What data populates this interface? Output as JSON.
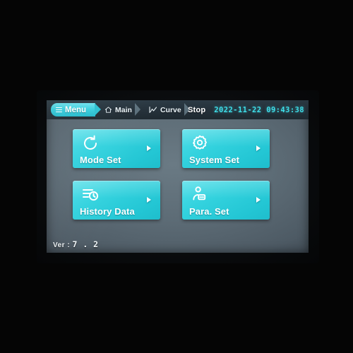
{
  "device": {
    "screen_label": "hmi-touch-panel"
  },
  "topbar": {
    "menu_label": "Menu",
    "menu_icon": "hamburger-icon",
    "breadcrumbs": [
      {
        "label": "Main",
        "icon": "home-icon"
      },
      {
        "label": "Curve",
        "icon": "line-chart-icon"
      }
    ],
    "status": "Stop",
    "datetime": "2022-11-22 09:43:38",
    "accent_color": "#3acfde",
    "bar_color": "#243039",
    "datetime_color": "#3fe0ea"
  },
  "menu": {
    "tiles": [
      {
        "label": "Mode Set",
        "icon": "rotate-ccw-icon",
        "arrow": "chevron-right-icon"
      },
      {
        "label": "System Set",
        "icon": "gear-icon",
        "arrow": "chevron-right-icon"
      },
      {
        "label": "History Data",
        "icon": "history-log-icon",
        "arrow": "chevron-right-icon"
      },
      {
        "label": "Para. Set",
        "icon": "user-card-icon",
        "arrow": "chevron-right-icon"
      }
    ],
    "tile_color": "#33d2de"
  },
  "footer": {
    "version_prefix": "Ver :",
    "version_number": "7 . 2"
  }
}
